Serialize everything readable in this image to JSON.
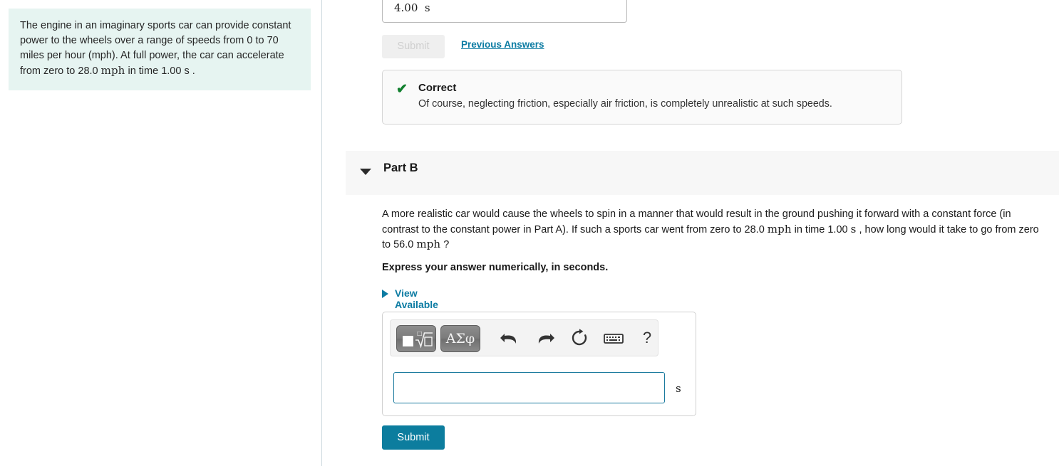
{
  "problem_statement": {
    "text_part1": "The engine in an imaginary sports car can provide constant power to the wheels over a range of speeds from 0 to 70 miles per hour (mph). At full power, the car can accelerate from zero to 28.0 ",
    "unit_mph": "mph",
    "text_part2": " in time 1.00 ",
    "unit_s": "s",
    "text_part3": " ."
  },
  "part_a": {
    "answer_value": "4.00  s",
    "submit_label": "Submit",
    "previous_answers_label": "Previous Answers",
    "feedback": {
      "check_icon": "check-icon",
      "title": "Correct",
      "detail": "Of course, neglecting friction, especially air friction, is completely unrealistic at such speeds."
    }
  },
  "part_b": {
    "caret_icon": "chevron-down-icon",
    "title": "Part B",
    "question": {
      "text_part1": "A more realistic car would cause the wheels to spin in a manner that would result in the ground pushing it forward with a constant force (in contrast to the constant power in Part A). If such a sports car went from zero to 28.0 ",
      "unit_mph_1": "mph",
      "text_part2": " in time 1.00 ",
      "unit_s": "s",
      "text_part3": " , how long would it take to go from zero to 56.0 ",
      "unit_mph_2": "mph",
      "text_part4": " ?"
    },
    "instruction": "Express your answer numerically, in seconds.",
    "hints": {
      "caret_icon": "triangle-right-icon",
      "label": "View Available Hint(s)"
    },
    "math_toolbar": {
      "template_button": {
        "icon": "square-root-template-icon",
        "label": ""
      },
      "greek_button": {
        "icon": "greek-symbols-icon",
        "label": "ΑΣφ"
      },
      "undo": "undo-arrow-icon",
      "redo": "redo-arrow-icon",
      "reset": "reset-circular-arrow-icon",
      "keyboard": "keyboard-icon",
      "help": "question-mark-icon",
      "help_label": "?"
    },
    "answer_input": {
      "value": "",
      "placeholder": "",
      "unit": "s"
    },
    "submit_label": "Submit"
  },
  "colors": {
    "statement_background": "#e6f4f1",
    "link_teal": "#0d7ca3",
    "submit_teal": "#0c7d9e",
    "correct_green": "#12802f",
    "part_header_gray": "#f7f7f7",
    "input_focus_border": "#1b7a9e"
  }
}
